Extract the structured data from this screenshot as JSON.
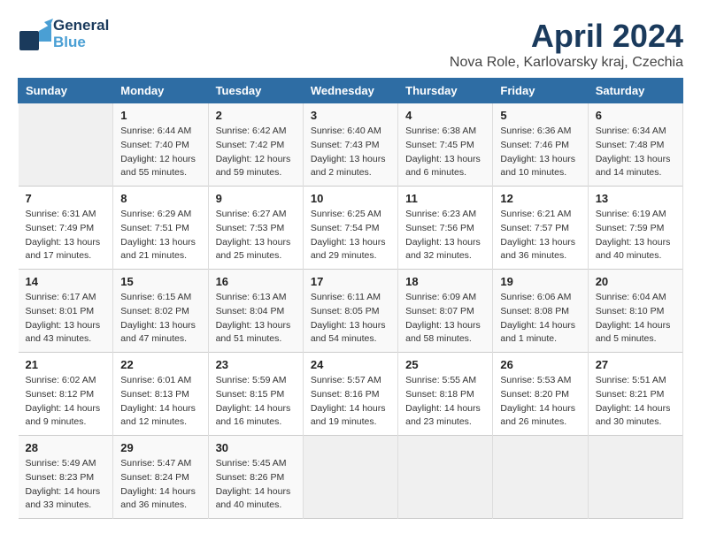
{
  "header": {
    "logo_line1": "General",
    "logo_line2": "Blue",
    "title": "April 2024",
    "subtitle": "Nova Role, Karlovarsky kraj, Czechia"
  },
  "columns": [
    "Sunday",
    "Monday",
    "Tuesday",
    "Wednesday",
    "Thursday",
    "Friday",
    "Saturday"
  ],
  "weeks": [
    [
      {
        "day": "",
        "info": ""
      },
      {
        "day": "1",
        "info": "Sunrise: 6:44 AM\nSunset: 7:40 PM\nDaylight: 12 hours\nand 55 minutes."
      },
      {
        "day": "2",
        "info": "Sunrise: 6:42 AM\nSunset: 7:42 PM\nDaylight: 12 hours\nand 59 minutes."
      },
      {
        "day": "3",
        "info": "Sunrise: 6:40 AM\nSunset: 7:43 PM\nDaylight: 13 hours\nand 2 minutes."
      },
      {
        "day": "4",
        "info": "Sunrise: 6:38 AM\nSunset: 7:45 PM\nDaylight: 13 hours\nand 6 minutes."
      },
      {
        "day": "5",
        "info": "Sunrise: 6:36 AM\nSunset: 7:46 PM\nDaylight: 13 hours\nand 10 minutes."
      },
      {
        "day": "6",
        "info": "Sunrise: 6:34 AM\nSunset: 7:48 PM\nDaylight: 13 hours\nand 14 minutes."
      }
    ],
    [
      {
        "day": "7",
        "info": "Sunrise: 6:31 AM\nSunset: 7:49 PM\nDaylight: 13 hours\nand 17 minutes."
      },
      {
        "day": "8",
        "info": "Sunrise: 6:29 AM\nSunset: 7:51 PM\nDaylight: 13 hours\nand 21 minutes."
      },
      {
        "day": "9",
        "info": "Sunrise: 6:27 AM\nSunset: 7:53 PM\nDaylight: 13 hours\nand 25 minutes."
      },
      {
        "day": "10",
        "info": "Sunrise: 6:25 AM\nSunset: 7:54 PM\nDaylight: 13 hours\nand 29 minutes."
      },
      {
        "day": "11",
        "info": "Sunrise: 6:23 AM\nSunset: 7:56 PM\nDaylight: 13 hours\nand 32 minutes."
      },
      {
        "day": "12",
        "info": "Sunrise: 6:21 AM\nSunset: 7:57 PM\nDaylight: 13 hours\nand 36 minutes."
      },
      {
        "day": "13",
        "info": "Sunrise: 6:19 AM\nSunset: 7:59 PM\nDaylight: 13 hours\nand 40 minutes."
      }
    ],
    [
      {
        "day": "14",
        "info": "Sunrise: 6:17 AM\nSunset: 8:01 PM\nDaylight: 13 hours\nand 43 minutes."
      },
      {
        "day": "15",
        "info": "Sunrise: 6:15 AM\nSunset: 8:02 PM\nDaylight: 13 hours\nand 47 minutes."
      },
      {
        "day": "16",
        "info": "Sunrise: 6:13 AM\nSunset: 8:04 PM\nDaylight: 13 hours\nand 51 minutes."
      },
      {
        "day": "17",
        "info": "Sunrise: 6:11 AM\nSunset: 8:05 PM\nDaylight: 13 hours\nand 54 minutes."
      },
      {
        "day": "18",
        "info": "Sunrise: 6:09 AM\nSunset: 8:07 PM\nDaylight: 13 hours\nand 58 minutes."
      },
      {
        "day": "19",
        "info": "Sunrise: 6:06 AM\nSunset: 8:08 PM\nDaylight: 14 hours\nand 1 minute."
      },
      {
        "day": "20",
        "info": "Sunrise: 6:04 AM\nSunset: 8:10 PM\nDaylight: 14 hours\nand 5 minutes."
      }
    ],
    [
      {
        "day": "21",
        "info": "Sunrise: 6:02 AM\nSunset: 8:12 PM\nDaylight: 14 hours\nand 9 minutes."
      },
      {
        "day": "22",
        "info": "Sunrise: 6:01 AM\nSunset: 8:13 PM\nDaylight: 14 hours\nand 12 minutes."
      },
      {
        "day": "23",
        "info": "Sunrise: 5:59 AM\nSunset: 8:15 PM\nDaylight: 14 hours\nand 16 minutes."
      },
      {
        "day": "24",
        "info": "Sunrise: 5:57 AM\nSunset: 8:16 PM\nDaylight: 14 hours\nand 19 minutes."
      },
      {
        "day": "25",
        "info": "Sunrise: 5:55 AM\nSunset: 8:18 PM\nDaylight: 14 hours\nand 23 minutes."
      },
      {
        "day": "26",
        "info": "Sunrise: 5:53 AM\nSunset: 8:20 PM\nDaylight: 14 hours\nand 26 minutes."
      },
      {
        "day": "27",
        "info": "Sunrise: 5:51 AM\nSunset: 8:21 PM\nDaylight: 14 hours\nand 30 minutes."
      }
    ],
    [
      {
        "day": "28",
        "info": "Sunrise: 5:49 AM\nSunset: 8:23 PM\nDaylight: 14 hours\nand 33 minutes."
      },
      {
        "day": "29",
        "info": "Sunrise: 5:47 AM\nSunset: 8:24 PM\nDaylight: 14 hours\nand 36 minutes."
      },
      {
        "day": "30",
        "info": "Sunrise: 5:45 AM\nSunset: 8:26 PM\nDaylight: 14 hours\nand 40 minutes."
      },
      {
        "day": "",
        "info": ""
      },
      {
        "day": "",
        "info": ""
      },
      {
        "day": "",
        "info": ""
      },
      {
        "day": "",
        "info": ""
      }
    ]
  ]
}
